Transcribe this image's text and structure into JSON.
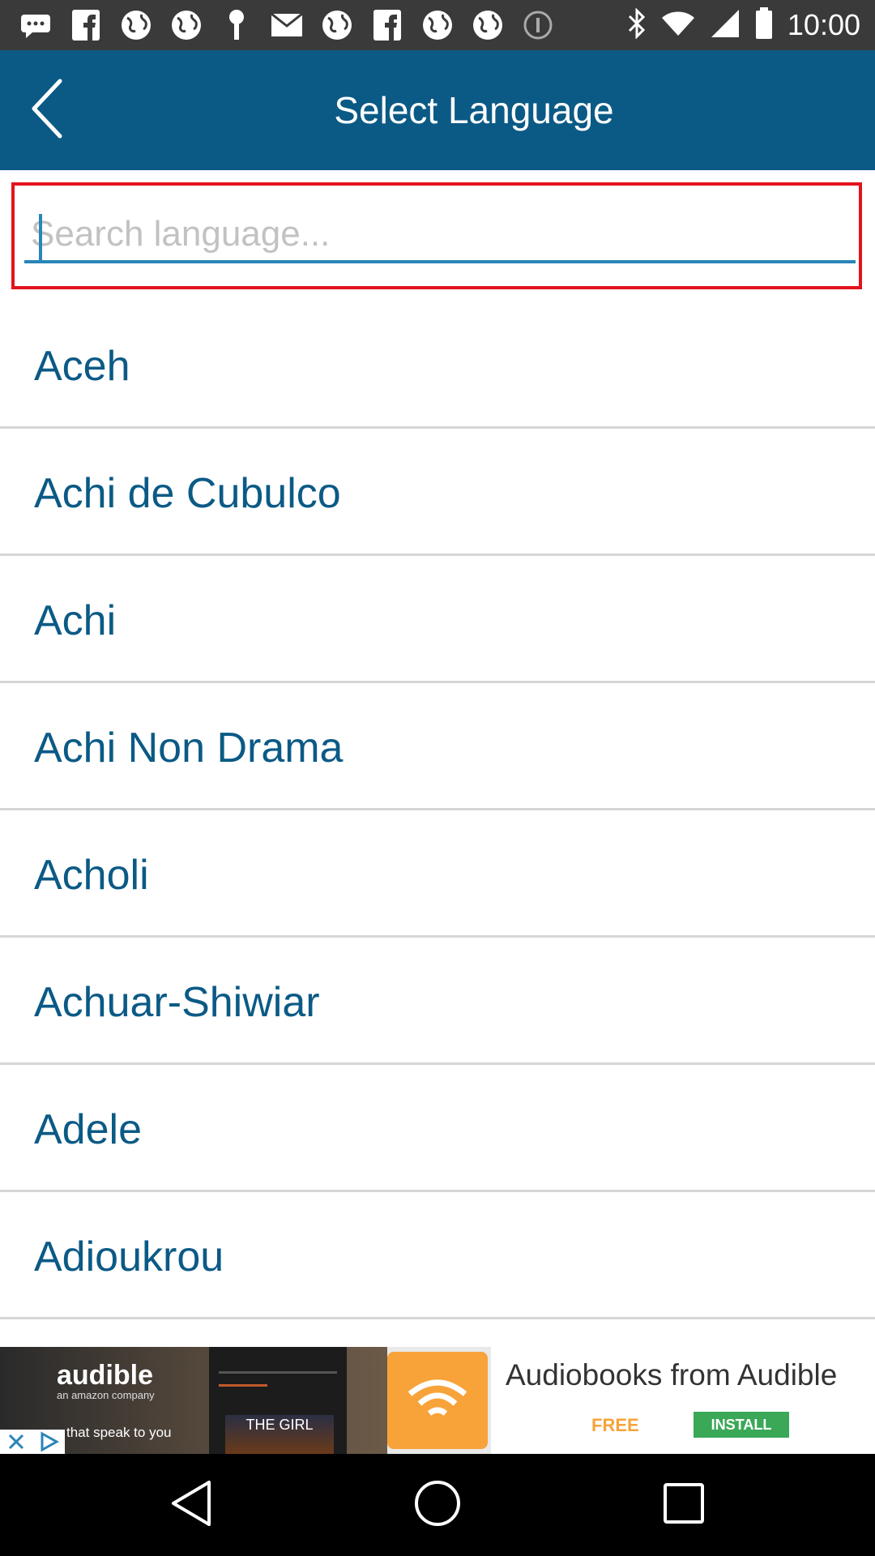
{
  "status_bar": {
    "time": "10:00",
    "left_icons": [
      "message-icon",
      "facebook-icon",
      "globe-icon",
      "globe-icon",
      "location-pin-icon",
      "mail-icon",
      "globe-icon",
      "facebook-icon",
      "globe-icon",
      "globe-icon",
      "info-icon"
    ],
    "right_icons": [
      "bluetooth-icon",
      "wifi-icon",
      "signal-icon",
      "battery-icon"
    ]
  },
  "app_bar": {
    "title": "Select Language",
    "back_icon": "back-arrow-icon",
    "background_color": "#0b5a86"
  },
  "search": {
    "placeholder": "Search language...",
    "value": "",
    "highlight_color": "#e3141c",
    "underline_color": "#2a85b8"
  },
  "languages": [
    "Aceh",
    "Achi de Cubulco",
    "Achi",
    "Achi Non Drama",
    "Acholi",
    "Achuar-Shiwiar",
    "Adele",
    "Adioukrou"
  ],
  "ad": {
    "brand": "audible",
    "brand_sub": "an amazon company",
    "tagline": "that speak to you",
    "book_text": "THE GIRL",
    "headline": "Audiobooks from Audible",
    "free_label": "FREE",
    "install_label": "INSTALL"
  },
  "nav_bar": {
    "buttons": [
      "back-triangle-icon",
      "home-circle-icon",
      "recents-square-icon"
    ]
  }
}
